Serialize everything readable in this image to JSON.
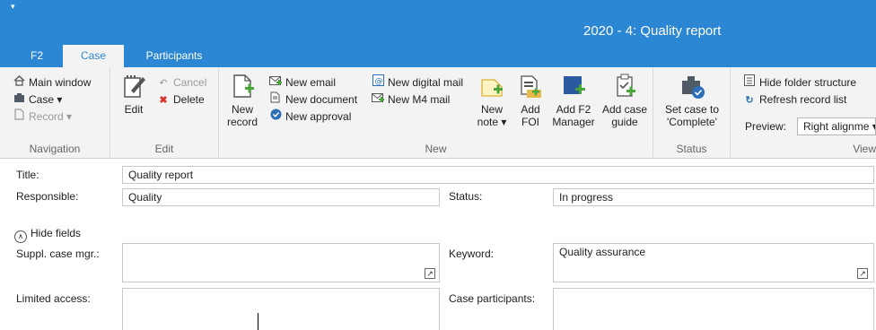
{
  "window": {
    "title": "2020 - 4: Quality report",
    "qat_icon": "▾"
  },
  "tabs": [
    {
      "label": "F2",
      "active": false
    },
    {
      "label": "Case",
      "active": true
    },
    {
      "label": "Participants",
      "active": false
    }
  ],
  "ribbon": {
    "navigation": {
      "group_label": "Navigation",
      "main_window": "Main window",
      "case": "Case ▾",
      "record": "Record ▾"
    },
    "edit": {
      "group_label": "Edit",
      "edit": "Edit",
      "cancel": "Cancel",
      "delete": "Delete"
    },
    "new": {
      "group_label": "New",
      "new_record_1": "New",
      "new_record_2": "record",
      "new_email": "New email",
      "new_document": "New document",
      "new_approval": "New approval",
      "new_digital_mail": "New digital mail",
      "new_m4_mail": "New M4 mail",
      "new_note_1": "New",
      "new_note_2": "note ▾",
      "add_foi_1": "Add",
      "add_foi_2": "FOI",
      "add_f2_manager_1": "Add F2",
      "add_f2_manager_2": "Manager",
      "add_case_guide_1": "Add case",
      "add_case_guide_2": "guide"
    },
    "status": {
      "group_label": "Status",
      "set_case_1": "Set case to",
      "set_case_2": "'Complete'"
    },
    "view": {
      "group_label": "View",
      "hide_folder_structure": "Hide folder structure",
      "refresh_record_list": "Refresh record list",
      "preview_label": "Preview:",
      "preview_value": "Right alignme ▾"
    }
  },
  "form": {
    "title_label": "Title:",
    "title_value": "Quality report",
    "responsible_label": "Responsible:",
    "responsible_value": "Quality",
    "status_label": "Status:",
    "status_value": "In progress",
    "hide_fields": "Hide fields",
    "suppl_case_mgr_label": "Suppl. case mgr.:",
    "suppl_case_mgr_value": "",
    "keyword_label": "Keyword:",
    "keyword_value": "Quality assurance",
    "limited_access_label": "Limited access:",
    "limited_access_value": "",
    "case_participants_label": "Case participants:",
    "case_participants_value": ""
  },
  "colors": {
    "accent": "#2b87d3",
    "ribbon_bg": "#f3f3f3",
    "delete_red": "#d9342b"
  }
}
